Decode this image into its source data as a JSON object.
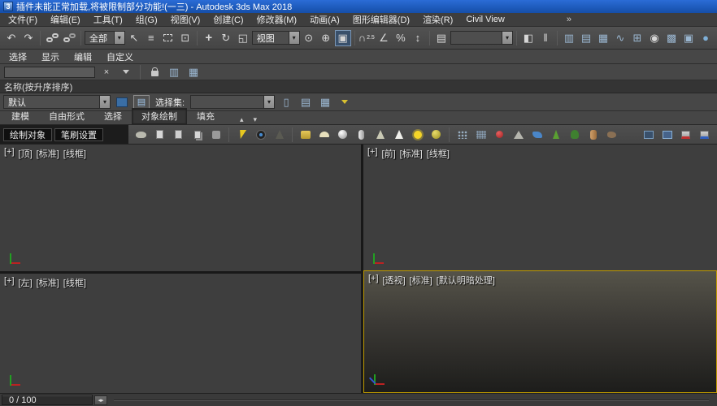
{
  "colors": {
    "titlebar_blue": "#2b6cd6",
    "active_viewport_border": "#bf9b00",
    "funnel_yellow": "#d8c030"
  },
  "titlebar": {
    "icon_label": "3",
    "title": "插件未能正常加载,将被限制部分功能!(一三) - Autodesk 3ds Max 2018"
  },
  "menubar": {
    "items": [
      "文件(F)",
      "编辑(E)",
      "工具(T)",
      "组(G)",
      "视图(V)",
      "创建(C)",
      "修改器(M)",
      "动画(A)",
      "图形编辑器(D)",
      "渲染(R)",
      "Civil View"
    ],
    "overflow": "»"
  },
  "glyphs": {
    "undo": "↶",
    "redo": "↷",
    "select": "↖",
    "select_by_name": "≡",
    "window_crossing": "⊡",
    "move": "+",
    "rotate": "↻",
    "scale": "◱",
    "pivot_center": "⊙",
    "manipulate": "⊕",
    "keyboard_override": "▣",
    "snap_magnet": "∩",
    "angle_snap": "∠",
    "percent_snap": "%",
    "spinner_snap": "↕",
    "edit_named_sets": "▤",
    "mirror": "◧",
    "align": "‖",
    "scene_explorer": "▥",
    "layer_explorer": "▤",
    "ribbon_toggle": "▦",
    "curve_editor": "∿",
    "schematic": "⊞",
    "material_editor": "◉",
    "render_setup": "▩",
    "render_frame": "▣",
    "render": "●",
    "dropdown": "▾",
    "clear": "×",
    "minimize": "▴",
    "slider_nav": "◂▸",
    "columns": "▤",
    "search_opt_a": "▥",
    "search_opt_b": "▦",
    "set_new": "▯",
    "set_add": "▤",
    "set_edit": "▦"
  },
  "main_toolbar": {
    "selection_filter_value": "全部",
    "coordsys_value": "视图",
    "named_sets_value": "",
    "snap_value": "2.5"
  },
  "explorer": {
    "tabs": [
      "选择",
      "显示",
      "编辑",
      "自定义"
    ],
    "search_value": "",
    "header": "名称(按升序排序)",
    "preset_value": "默认",
    "selection_set_label": "选择集:",
    "selection_set_value": ""
  },
  "ribbon": {
    "tabs": [
      "建模",
      "自由形式",
      "选择",
      "对象绘制",
      "填充"
    ],
    "active_tab": "对象绘制"
  },
  "object_paint": {
    "buttons": [
      "绘制对象",
      "笔刷设置"
    ],
    "strip_icons": [
      "teapot",
      "page-new",
      "page-open",
      "pages",
      "spray",
      "lightning",
      "camera",
      "cone-dark",
      "box",
      "dome",
      "sphere",
      "capsule",
      "cone",
      "cone-white",
      "sun",
      "geosphere",
      "scatter-a",
      "scatter-b",
      "apple",
      "pyramid",
      "wave",
      "grass",
      "tree",
      "barrel",
      "rock",
      "panel-a",
      "panel-b",
      "tool-red",
      "tool-blue"
    ]
  },
  "viewports": {
    "top": {
      "labels": [
        "[+]",
        "[顶]",
        "[标准]",
        "[线框]"
      ]
    },
    "front": {
      "labels": [
        "[+]",
        "[前]",
        "[标准]",
        "[线框]"
      ]
    },
    "left": {
      "labels": [
        "[+]",
        "[左]",
        "[标准]",
        "[线框]"
      ]
    },
    "perspective": {
      "labels": [
        "[+]",
        "[透视]",
        "[标准]",
        "[默认明暗处理]"
      ]
    }
  },
  "timebar": {
    "frame_label": "0 / 100"
  }
}
